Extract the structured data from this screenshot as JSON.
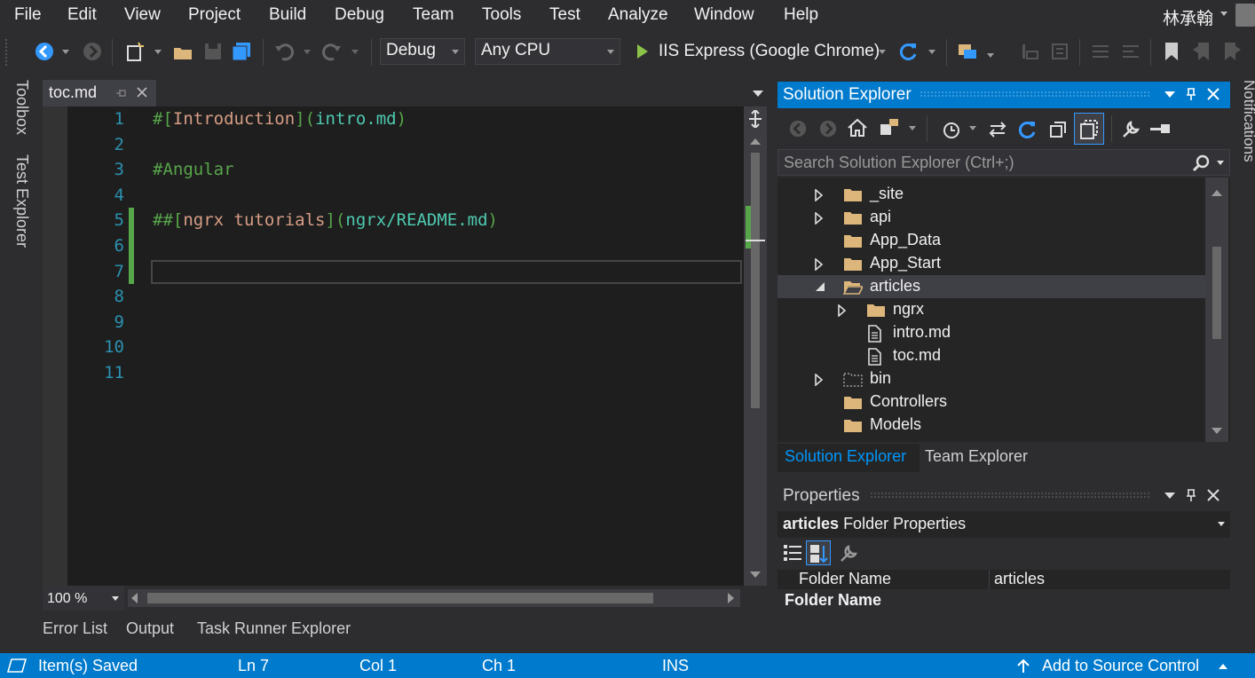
{
  "menu": {
    "items": [
      "File",
      "Edit",
      "View",
      "Project",
      "Build",
      "Debug",
      "Team",
      "Tools",
      "Test",
      "Analyze",
      "Window",
      "Help"
    ],
    "user": "林承翰"
  },
  "toolbar": {
    "configuration": "Debug",
    "platform": "Any CPU",
    "run_target": "IIS Express (Google Chrome)"
  },
  "left_tabs": [
    "Toolbox",
    "Test Explorer"
  ],
  "editor": {
    "tab_title": "toc.md",
    "lines": [
      {
        "num": "1",
        "tokens": [
          {
            "t": "#[",
            "c": "c-green"
          },
          {
            "t": "Introduction",
            "c": "c-orange"
          },
          {
            "t": "](",
            "c": "c-green"
          },
          {
            "t": "intro.md",
            "c": "c-teal"
          },
          {
            "t": ")",
            "c": "c-green"
          }
        ]
      },
      {
        "num": "2",
        "tokens": []
      },
      {
        "num": "3",
        "tokens": [
          {
            "t": "#Angular",
            "c": "c-green"
          }
        ]
      },
      {
        "num": "4",
        "tokens": []
      },
      {
        "num": "5",
        "tokens": [
          {
            "t": "##[",
            "c": "c-green"
          },
          {
            "t": "ngrx tutorials",
            "c": "c-orange"
          },
          {
            "t": "](",
            "c": "c-green"
          },
          {
            "t": "ngrx/README.md",
            "c": "c-teal"
          },
          {
            "t": ")",
            "c": "c-green"
          }
        ]
      },
      {
        "num": "6",
        "tokens": []
      },
      {
        "num": "7",
        "tokens": []
      },
      {
        "num": "8",
        "tokens": []
      },
      {
        "num": "9",
        "tokens": []
      },
      {
        "num": "10",
        "tokens": []
      },
      {
        "num": "11",
        "tokens": []
      }
    ],
    "zoom": "100 %"
  },
  "bottom_tabs": [
    "Error List",
    "Output",
    "Task Runner Explorer"
  ],
  "solution_explorer": {
    "title": "Solution Explorer",
    "search_placeholder": "Search Solution Explorer (Ctrl+;)",
    "tree": [
      {
        "label": "_site",
        "level": 0,
        "expander": "collapsed",
        "icon": "folder-icon"
      },
      {
        "label": "api",
        "level": 0,
        "expander": "collapsed",
        "icon": "folder-icon"
      },
      {
        "label": "App_Data",
        "level": 0,
        "expander": "none",
        "icon": "folder-icon"
      },
      {
        "label": "App_Start",
        "level": 0,
        "expander": "collapsed",
        "icon": "folder-icon"
      },
      {
        "label": "articles",
        "level": 0,
        "expander": "expanded",
        "icon": "folder-open-icon",
        "selected": true
      },
      {
        "label": "ngrx",
        "level": 1,
        "expander": "collapsed",
        "icon": "folder-icon"
      },
      {
        "label": "intro.md",
        "level": 1,
        "expander": "none",
        "icon": "file-icon"
      },
      {
        "label": "toc.md",
        "level": 1,
        "expander": "none",
        "icon": "file-icon"
      },
      {
        "label": "bin",
        "level": 0,
        "expander": "collapsed",
        "icon": "folder-excluded-icon"
      },
      {
        "label": "Controllers",
        "level": 0,
        "expander": "none",
        "icon": "folder-icon"
      },
      {
        "label": "Models",
        "level": 0,
        "expander": "none",
        "icon": "folder-icon"
      }
    ],
    "tabs": [
      "Solution Explorer",
      "Team Explorer"
    ]
  },
  "properties": {
    "title": "Properties",
    "object_name": "articles",
    "object_type": "Folder Properties",
    "row_name": "Folder Name",
    "row_value": "articles",
    "description_title": "Folder Name"
  },
  "notifications_label": "Notifications",
  "statusbar": {
    "message": "Item(s) Saved",
    "line": "Ln 7",
    "col": "Col 1",
    "ch": "Ch 1",
    "mode": "INS",
    "source_control": "Add to Source Control"
  }
}
